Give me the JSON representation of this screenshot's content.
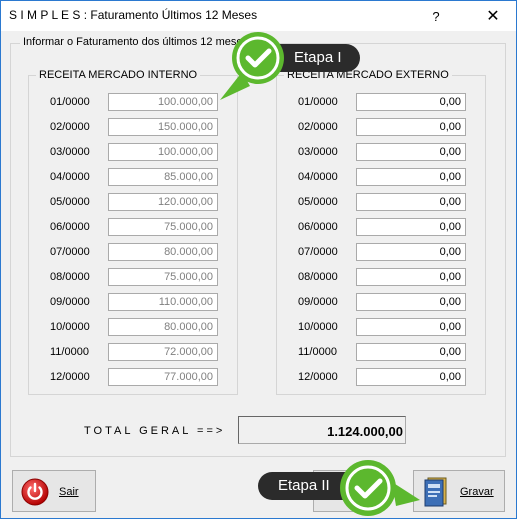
{
  "window": {
    "title": "S I M P L E S : Faturamento Últimos 12 Meses",
    "help_glyph": "?",
    "close_glyph": "✕"
  },
  "form": {
    "outer_legend": "Informar o Faturamento dos últimos 12 meses",
    "interno": {
      "legend": "RECEITA MERCADO INTERNO",
      "rows": [
        {
          "month": "01/0000",
          "value": "100.000,00"
        },
        {
          "month": "02/0000",
          "value": "150.000,00"
        },
        {
          "month": "03/0000",
          "value": "100.000,00"
        },
        {
          "month": "04/0000",
          "value": "85.000,00"
        },
        {
          "month": "05/0000",
          "value": "120.000,00"
        },
        {
          "month": "06/0000",
          "value": "75.000,00"
        },
        {
          "month": "07/0000",
          "value": "80.000,00"
        },
        {
          "month": "08/0000",
          "value": "75.000,00"
        },
        {
          "month": "09/0000",
          "value": "110.000,00"
        },
        {
          "month": "10/0000",
          "value": "80.000,00"
        },
        {
          "month": "11/0000",
          "value": "72.000,00"
        },
        {
          "month": "12/0000",
          "value": "77.000,00"
        }
      ]
    },
    "externo": {
      "legend": "RECEITA MERCADO EXTERNO",
      "rows": [
        {
          "month": "01/0000",
          "value": "0,00"
        },
        {
          "month": "02/0000",
          "value": "0,00"
        },
        {
          "month": "03/0000",
          "value": "0,00"
        },
        {
          "month": "04/0000",
          "value": "0,00"
        },
        {
          "month": "05/0000",
          "value": "0,00"
        },
        {
          "month": "06/0000",
          "value": "0,00"
        },
        {
          "month": "07/0000",
          "value": "0,00"
        },
        {
          "month": "08/0000",
          "value": "0,00"
        },
        {
          "month": "09/0000",
          "value": "0,00"
        },
        {
          "month": "10/0000",
          "value": "0,00"
        },
        {
          "month": "11/0000",
          "value": "0,00"
        },
        {
          "month": "12/0000",
          "value": "0,00"
        }
      ]
    },
    "total_label": "TOTAL GERAL ==>",
    "total_value": "1.124.000,00"
  },
  "buttons": {
    "exit_label": "Sair",
    "exit_icon": "power-icon",
    "save_label": "Gravar",
    "save_icon": "book-icon"
  },
  "annotations": {
    "step1": "Etapa I",
    "step2": "Etapa II",
    "badge_icon": "checkmark-icon",
    "badge_color": "#5cb82e",
    "callout_color": "#2b2b2b"
  }
}
